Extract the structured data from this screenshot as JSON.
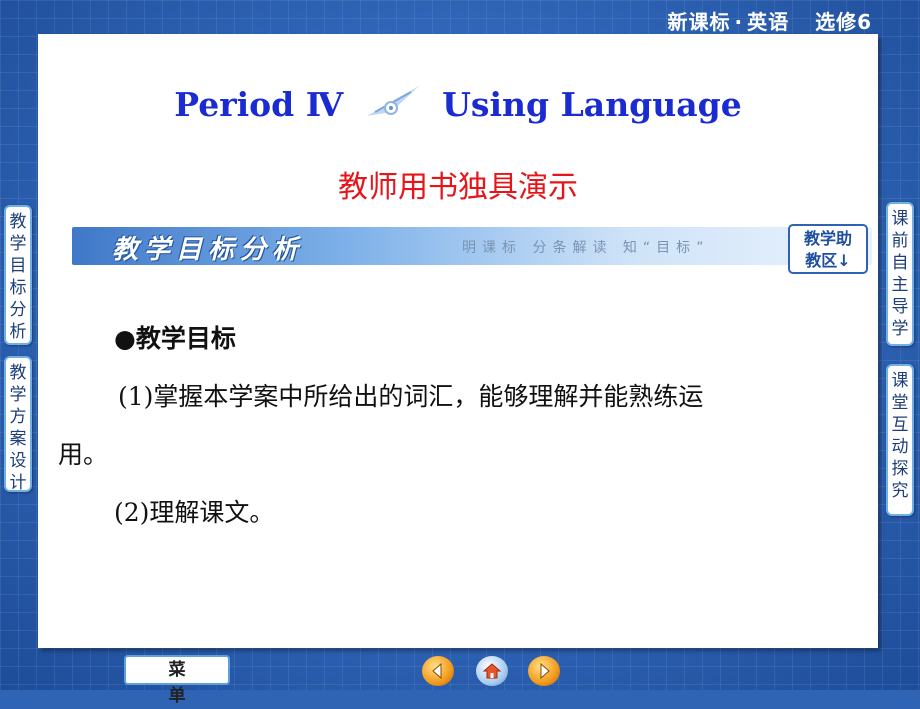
{
  "header": {
    "series": "新课标",
    "separator": "·",
    "subject": "英语",
    "module": "选修6"
  },
  "slide": {
    "title_part1": "Period Ⅳ",
    "title_part2": "Using Language",
    "subtitle": "教师用书独具演示",
    "section_title": "教学目标分析",
    "section_subtitle": "明课标  分条解读  知“目标”",
    "helper_label_line1": "教学助",
    "helper_label_line2": "教区↓",
    "heading": "●教学目标",
    "item1": "(1)掌握本学案中所给出的词汇，能够理解并能熟练运",
    "item1_cont": "用。",
    "item2": "(2)理解课文。"
  },
  "left_tabs": [
    {
      "label": [
        "教",
        "学",
        "目",
        "标",
        "分",
        "析"
      ]
    },
    {
      "label": [
        "教",
        "学",
        "方",
        "案",
        "设",
        "计"
      ]
    }
  ],
  "right_tabs": [
    {
      "label": [
        "课",
        "前",
        "自",
        "主",
        "导",
        "学"
      ]
    },
    {
      "label": [
        "课",
        "堂",
        "互",
        "动",
        "探",
        "究"
      ]
    }
  ],
  "footer": {
    "menu_label": "菜单",
    "prev_icon": "arrow-left-icon",
    "home_icon": "home-icon",
    "next_icon": "arrow-right-icon"
  }
}
